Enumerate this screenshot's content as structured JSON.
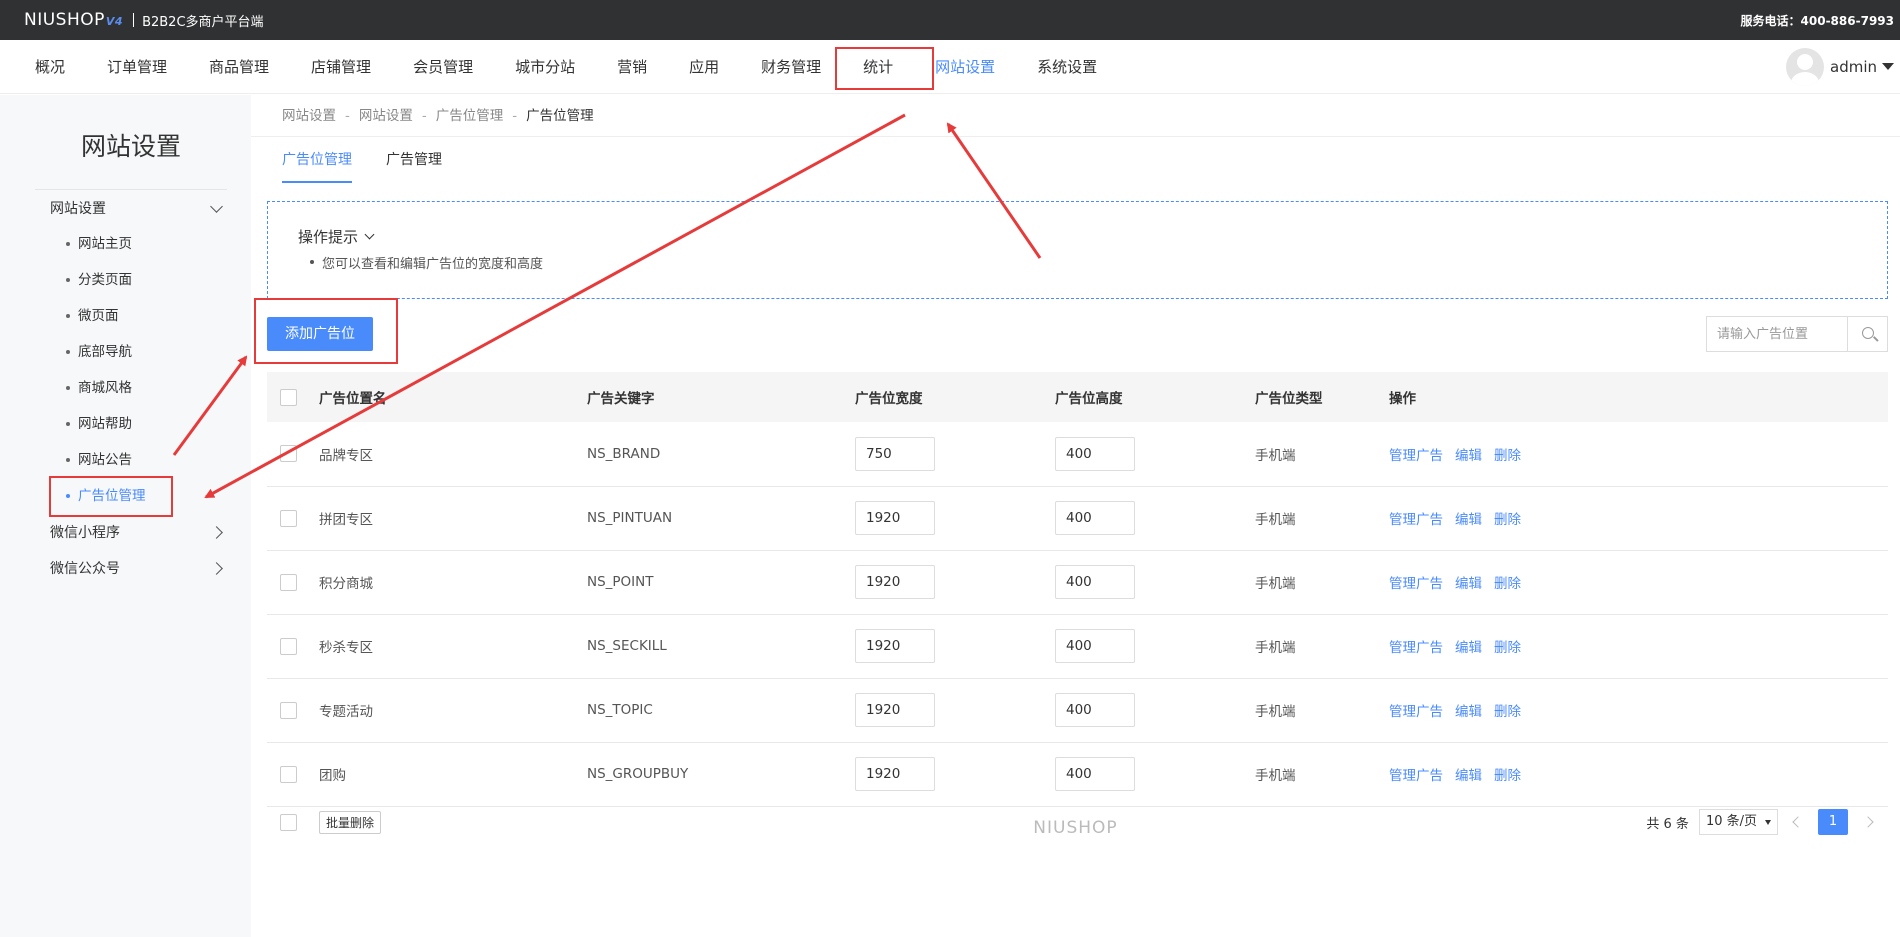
{
  "topbar": {
    "logo": "NIUSHOP",
    "logo_version": "V4",
    "platform": "B2B2C多商户平台端",
    "hotline": "服务电话：400-886-7993"
  },
  "nav": {
    "items": [
      "概况",
      "订单管理",
      "商品管理",
      "店铺管理",
      "会员管理",
      "城市分站",
      "营销",
      "应用",
      "财务管理",
      "统计",
      "网站设置",
      "系统设置"
    ],
    "active": "网站设置",
    "username": "admin"
  },
  "sidebar": {
    "title": "网站设置",
    "group1": "网站设置",
    "subitems": [
      "网站主页",
      "分类页面",
      "微页面",
      "底部导航",
      "商城风格",
      "网站帮助",
      "网站公告",
      "广告位管理"
    ],
    "group2": "微信小程序",
    "group3": "微信公众号"
  },
  "breadcrumb": [
    "网站设置",
    "网站设置",
    "广告位管理",
    "广告位管理"
  ],
  "tabs": [
    "广告位管理",
    "广告管理"
  ],
  "tips": {
    "title": "操作提示",
    "items": [
      "您可以查看和编辑广告位的宽度和高度"
    ]
  },
  "add_button": "添加广告位",
  "search": {
    "placeholder": "请输入广告位置"
  },
  "table": {
    "headers": [
      "广告位置名",
      "广告关键字",
      "广告位宽度",
      "广告位高度",
      "广告位类型",
      "操作"
    ],
    "rows": [
      {
        "name": "品牌专区",
        "key": "NS_BRAND",
        "width": "750",
        "height": "400",
        "type": "手机端"
      },
      {
        "name": "拼团专区",
        "key": "NS_PINTUAN",
        "width": "1920",
        "height": "400",
        "type": "手机端"
      },
      {
        "name": "积分商城",
        "key": "NS_POINT",
        "width": "1920",
        "height": "400",
        "type": "手机端"
      },
      {
        "name": "秒杀专区",
        "key": "NS_SECKILL",
        "width": "1920",
        "height": "400",
        "type": "手机端"
      },
      {
        "name": "专题活动",
        "key": "NS_TOPIC",
        "width": "1920",
        "height": "400",
        "type": "手机端"
      },
      {
        "name": "团购",
        "key": "NS_GROUPBUY",
        "width": "1920",
        "height": "400",
        "type": "手机端"
      }
    ],
    "actions": [
      "管理广告",
      "编辑",
      "删除"
    ]
  },
  "footer": {
    "batch_delete": "批量删除",
    "total": "共 6 条",
    "per_page": "10 条/页",
    "current_page": "1"
  },
  "watermark": "NIUSHOP",
  "colors": {
    "accent": "#4a8bfc",
    "annotation": "#e63b3b",
    "topbar": "#303133"
  }
}
